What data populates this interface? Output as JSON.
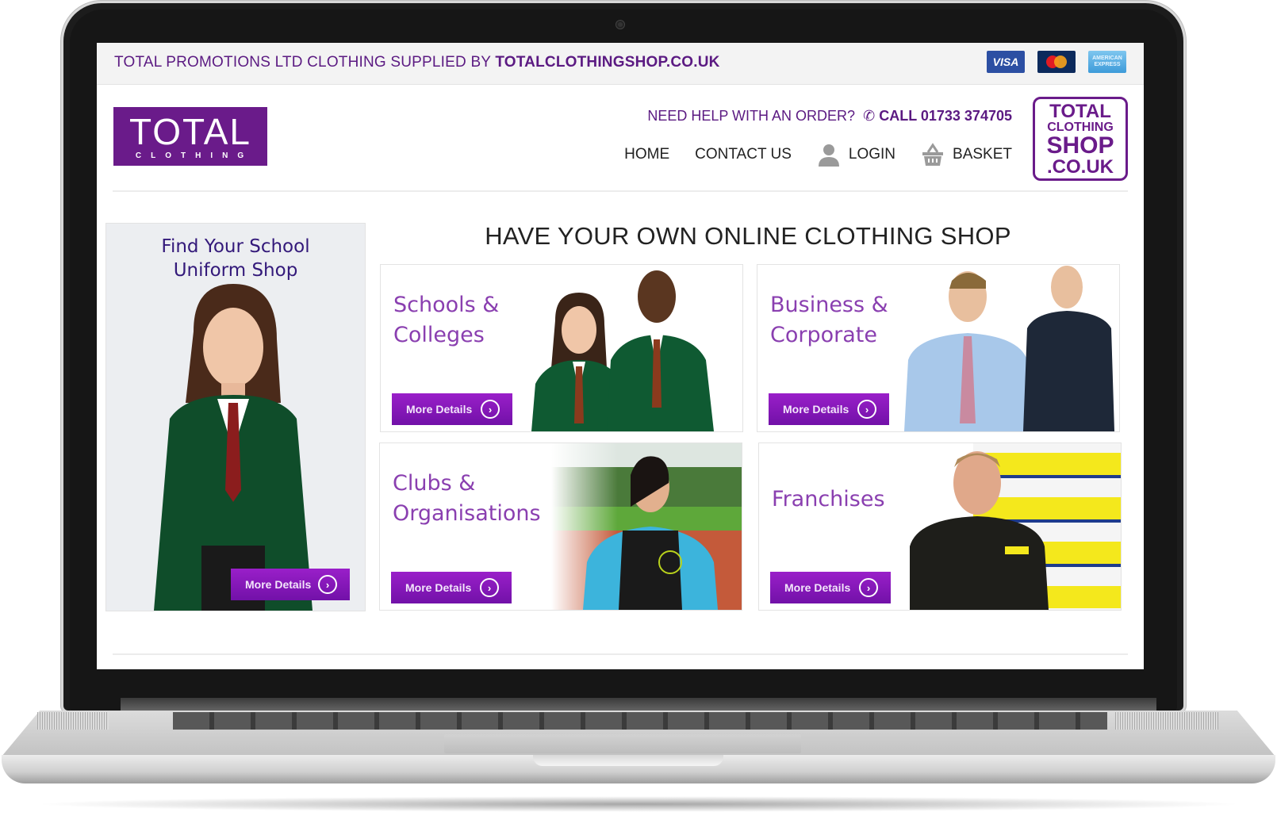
{
  "topbar": {
    "text_prefix": "TOTAL PROMOTIONS LTD CLOTHING SUPPLIED BY ",
    "text_bold": "TOTALCLOTHINGSHOP.CO.UK",
    "payment_cards": [
      "VISA",
      "MasterCard",
      "AMERICAN EXPRESS"
    ],
    "amex_line1": "AMERICAN",
    "amex_line2": "EXPRESS"
  },
  "header": {
    "logo_main": "TOTAL",
    "logo_sub": "CLOTHING",
    "help_text": "NEED HELP WITH AN ORDER?",
    "phone_label": "CALL 01733 374705",
    "nav": {
      "home": "HOME",
      "contact": "CONTACT US",
      "login": "LOGIN",
      "basket": "BASKET"
    },
    "shop_logo": [
      "TOTAL",
      "CLOTHING",
      "SHOP",
      ".CO.UK"
    ]
  },
  "sidebar": {
    "title_line1": "Find Your School",
    "title_line2": "Uniform Shop",
    "button": "More Details"
  },
  "main": {
    "headline": "HAVE YOUR OWN ONLINE CLOTHING SHOP",
    "tiles": [
      {
        "line1": "Schools &",
        "line2": "Colleges",
        "button": "More Details"
      },
      {
        "line1": "Business &",
        "line2": "Corporate",
        "button": "More Details"
      },
      {
        "line1": "Clubs &",
        "line2": "Organisations",
        "button": "More Details"
      },
      {
        "line1": "Franchises",
        "line2": "",
        "button": "More Details"
      }
    ]
  },
  "colors": {
    "brand_purple": "#6a1b8a",
    "button_purple": "#8a18bb",
    "tile_title": "#8a3fb0"
  }
}
